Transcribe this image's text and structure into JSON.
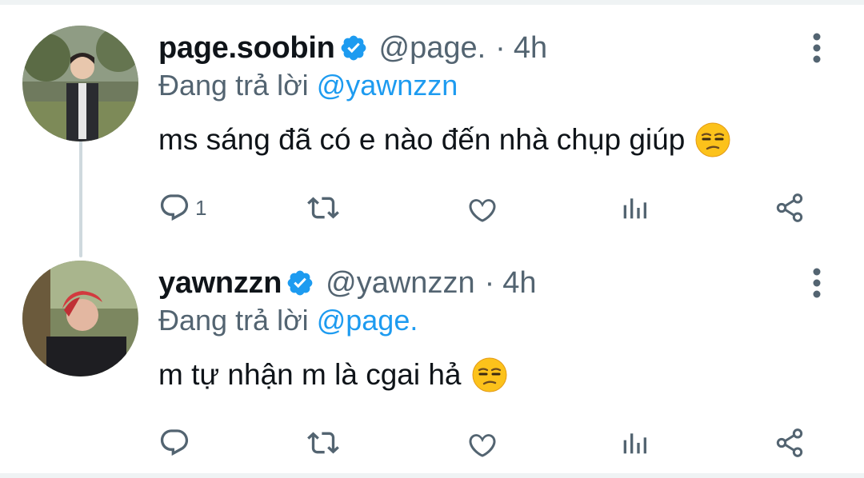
{
  "tweets": [
    {
      "display_name": "page.soobin",
      "handle": "@page.",
      "separator": "·",
      "time": "4h",
      "reply_prefix": "Đang trả lời",
      "reply_to": "@yawnzzn",
      "text": "ms sáng đã có e nào đến nhà chụp giúp",
      "emoji": "unamused-face",
      "reply_count": "1",
      "icons": [
        "reply-icon",
        "retweet-icon",
        "like-icon",
        "views-icon",
        "share-icon"
      ]
    },
    {
      "display_name": "yawnzzn",
      "handle": "@yawnzzn",
      "separator": "·",
      "time": "4h",
      "reply_prefix": "Đang trả lời",
      "reply_to": "@page.",
      "text": "m tự nhận m là cgai hả",
      "emoji": "unamused-face",
      "reply_count": "",
      "icons": [
        "reply-icon",
        "retweet-icon",
        "like-icon",
        "views-icon",
        "share-icon"
      ]
    }
  ],
  "colors": {
    "text": "#0f1419",
    "secondary": "#536471",
    "link": "#1d9bf0",
    "verified": "#1d9bf0",
    "divider": "#eff3f4",
    "thread_line": "#cfd9de"
  }
}
